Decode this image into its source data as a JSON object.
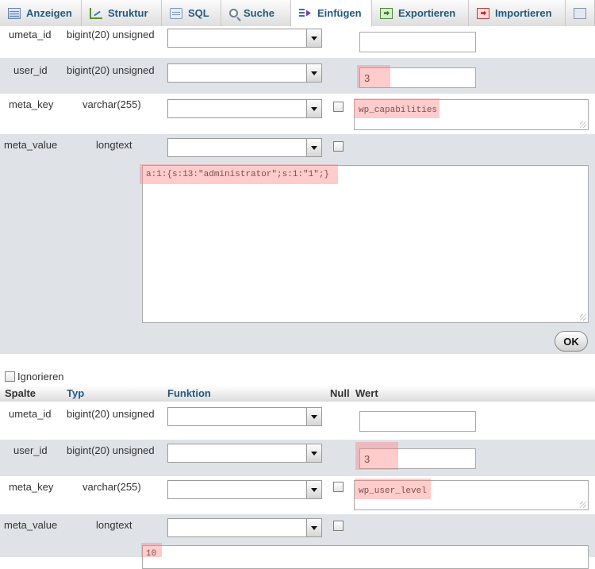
{
  "tabs": [
    {
      "label": "Anzeigen",
      "icon": "table-icon"
    },
    {
      "label": "Struktur",
      "icon": "structure-icon"
    },
    {
      "label": "SQL",
      "icon": "sql-icon"
    },
    {
      "label": "Suche",
      "icon": "search-icon"
    },
    {
      "label": "Einfügen",
      "icon": "insert-icon",
      "active": true
    },
    {
      "label": "Exportieren",
      "icon": "export-icon"
    },
    {
      "label": "Importieren",
      "icon": "import-icon"
    },
    {
      "label": "",
      "icon": "more-icon"
    }
  ],
  "form1": {
    "rows": [
      {
        "name": "umeta_id",
        "type": "bigint(20) unsigned",
        "value": ""
      },
      {
        "name": "user_id",
        "type": "bigint(20) unsigned",
        "value": "3"
      },
      {
        "name": "meta_key",
        "type": "varchar(255)",
        "value": "wp_capabilities"
      },
      {
        "name": "meta_value",
        "type": "longtext",
        "value": "a:1:{s:13:\"administrator\";s:1:\"1\";}"
      }
    ],
    "ok_label": "OK"
  },
  "ignore_label": "Ignorieren",
  "headers": {
    "column": "Spalte",
    "type": "Typ",
    "function": "Funktion",
    "null": "Null",
    "value": "Wert"
  },
  "form2": {
    "rows": [
      {
        "name": "umeta_id",
        "type": "bigint(20) unsigned",
        "value": ""
      },
      {
        "name": "user_id",
        "type": "bigint(20) unsigned",
        "value": "3"
      },
      {
        "name": "meta_key",
        "type": "varchar(255)",
        "value": "wp_user_level"
      },
      {
        "name": "meta_value",
        "type": "longtext",
        "value": "10"
      }
    ]
  },
  "colors": {
    "tab_text": "#235a81",
    "row_shade": "#dfe3e8",
    "highlight": "#ff7878"
  }
}
